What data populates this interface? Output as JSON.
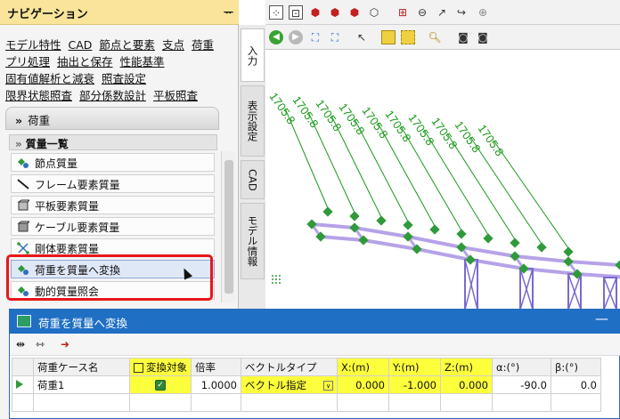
{
  "nav": {
    "title": "ナビゲーション",
    "pin": "ᅲ",
    "menu_rows": [
      [
        "モデル特性",
        "CAD",
        "節点と要素",
        "支点",
        "荷重"
      ],
      [
        "プリ処理",
        "抽出と保存",
        "性能基準"
      ],
      [
        "固有値解析と減衰",
        "照査設定"
      ],
      [
        "限界状態照査",
        "部分係数設計",
        "平板照査"
      ]
    ],
    "section": "荷重",
    "section_icon": "double-chevron-down-icon",
    "group_header": "質量一覧",
    "items": [
      {
        "label": "節点質量",
        "icon": "node-mass-icon"
      },
      {
        "label": "フレーム要素質量",
        "icon": "frame-mass-icon"
      },
      {
        "label": "平板要素質量",
        "icon": "plate-mass-icon"
      },
      {
        "label": "ケーブル要素質量",
        "icon": "cable-mass-icon"
      },
      {
        "label": "剛体要素質量",
        "icon": "rigid-mass-icon"
      },
      {
        "label": "荷重を質量へ変換",
        "icon": "load-to-mass-icon"
      },
      {
        "label": "動的質量照会",
        "icon": "dynamic-mass-icon"
      }
    ]
  },
  "vtabs": [
    "入力",
    "表示設定",
    "CAD",
    "モデル情報"
  ],
  "viewport": {
    "load_labels": [
      "1705.8",
      "1705.8",
      "1705.8",
      "1705.8",
      "1705.8",
      "1705.8",
      "1705.8",
      "1705.8",
      "1705.8",
      "1705.8"
    ],
    "colors": {
      "label": "#1a9a1a",
      "member": "#b6a2e8",
      "node": "#2f9a3a"
    }
  },
  "dialog": {
    "title": "荷重を質量へ変換",
    "minimize": "—",
    "columns": [
      "荷重ケース名",
      "変換対象",
      "倍率",
      "ベクトルタイプ",
      "X:(m)",
      "Y:(m)",
      "Z:(m)",
      "α:(°)",
      "β:(°)"
    ],
    "rows": [
      {
        "case": "荷重1",
        "target": "✓",
        "factor": "1.0000",
        "vector_type": "ベクトル指定",
        "x": "0.000",
        "y": "-1.000",
        "z": "0.000",
        "alpha": "-90.0",
        "beta": "0.0"
      }
    ],
    "highlight_color": "#fcff3b"
  }
}
